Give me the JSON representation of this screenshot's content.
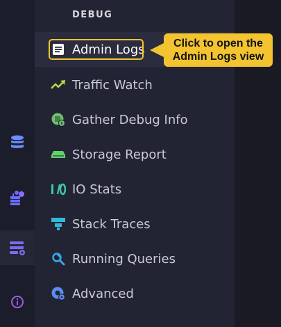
{
  "section": {
    "title": "DEBUG"
  },
  "rail": {
    "items": [
      {
        "icon": "database-icon",
        "color": "#6a8dff"
      },
      {
        "icon": "cluster-icon",
        "color": "#6a6cff"
      },
      {
        "icon": "settings-list-icon",
        "color": "#7a6cf0",
        "active": true
      },
      {
        "icon": "info-icon",
        "color": "#9b5fe0"
      }
    ]
  },
  "menu": {
    "items": [
      {
        "label": "Admin Logs",
        "icon": "document-icon",
        "color": "#ffffff",
        "active": true
      },
      {
        "label": "Traffic Watch",
        "icon": "trending-up-icon",
        "color": "#b9d84a"
      },
      {
        "label": "Gather Debug Info",
        "icon": "debug-package-icon",
        "color": "#6ec06e"
      },
      {
        "label": "Storage Report",
        "icon": "storage-drive-icon",
        "color": "#5fd16a"
      },
      {
        "label": "IO Stats",
        "icon": "io-stats-icon",
        "color": "#3ec9a7"
      },
      {
        "label": "Stack Traces",
        "icon": "stack-traces-icon",
        "color": "#34b8d9"
      },
      {
        "label": "Running Queries",
        "icon": "query-search-icon",
        "color": "#3aa8e8"
      },
      {
        "label": "Advanced",
        "icon": "advanced-gear-icon",
        "color": "#5b8cf0"
      }
    ]
  },
  "tooltip": {
    "line1": "Click to open the",
    "line2": "Admin Logs view",
    "color": "#f4c430"
  }
}
